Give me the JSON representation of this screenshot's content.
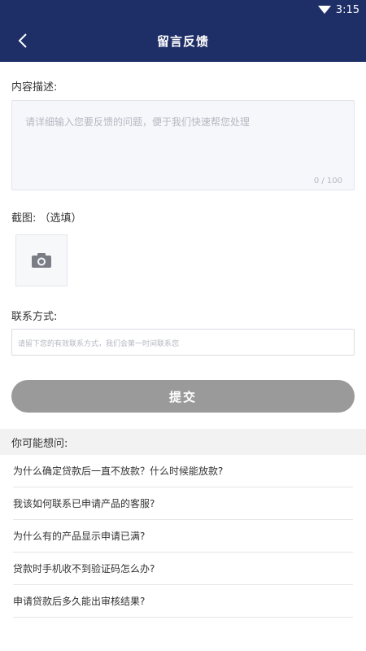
{
  "status_bar": {
    "time": "3:15"
  },
  "nav": {
    "title": "留言反馈"
  },
  "content": {
    "label": "内容描述:",
    "placeholder": "请详细输入您要反馈的问题，便于我们快速帮您处理",
    "counter": "0 / 100"
  },
  "screenshot": {
    "label": "截图: （选填）"
  },
  "contact": {
    "label": "联系方式:",
    "placeholder": "请留下您的有效联系方式，我们会第一时间联系您"
  },
  "submit": {
    "label": "提交"
  },
  "faq": {
    "title": "你可能想问:",
    "items": [
      {
        "label": "为什么确定贷款后一直不放款？什么时候能放款?"
      },
      {
        "label": "我该如何联系已申请产品的客服?"
      },
      {
        "label": "为什么有的产品显示申请已满?"
      },
      {
        "label": "贷款时手机收不到验证码怎么办?"
      },
      {
        "label": "申请贷款后多久能出审核结果?"
      }
    ]
  },
  "colors": {
    "header": "#1e2e66",
    "button": "#9a9a9a"
  }
}
